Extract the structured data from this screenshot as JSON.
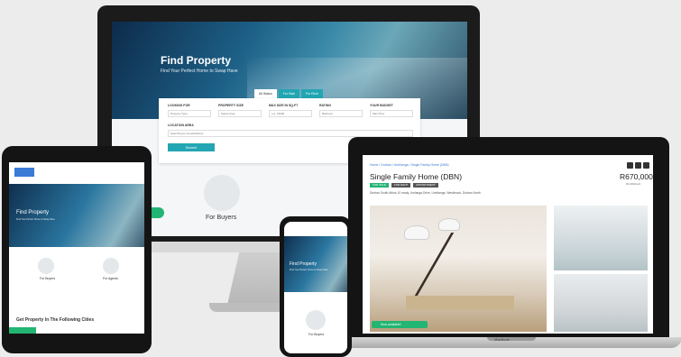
{
  "colors": {
    "accent": "#22a6b3",
    "success": "#22b573",
    "dark": "#141414"
  },
  "desktop": {
    "hero_title": "Find Property",
    "hero_subtitle": "Find Your Perfect Home to Swap Have",
    "tabs": [
      "All Status",
      "For Sale",
      "For Rent"
    ],
    "fields": [
      {
        "label": "LOOKING FOR",
        "value": "Property Type"
      },
      {
        "label": "PROPERTY SIZE",
        "value": "Select Area"
      },
      {
        "label": "MAX SIZE IN SQ.FT",
        "value": "e.g. 15000"
      },
      {
        "label": "RATING",
        "value": "Bedroom"
      },
      {
        "label": "YOUR BUDGET",
        "value": "Max Price"
      }
    ],
    "location_label": "LOCATION AREA",
    "location_value": "Searching by Area/Address",
    "search_button": "Search",
    "buyers_label": "For Buyers"
  },
  "tablet": {
    "hero_title": "Find Property",
    "hero_subtitle": "Find Your Perfect Home to Swap Have",
    "cards": [
      "For Buyers",
      "For Agents"
    ],
    "bottom_heading": "Get Property In The Following Cities"
  },
  "laptop": {
    "breadcrumb": "Home / Durban / Umhlanga / Single Family Home (DBN)",
    "title": "Single Family Home (DBN)",
    "price": "R670,000",
    "price_sub": "R1,000/sq.ft",
    "tags": [
      "FOR SALE",
      "FOR RENT",
      "APPOINTMENT"
    ],
    "address": "Durban South Africa 10 ready, Umlanga Drive, Umhlanga, Westbrook, Durban North",
    "status_button": "Now available!",
    "brand": "MacBook"
  },
  "phone": {
    "hero_title": "Find Property",
    "hero_subtitle": "Find Your Perfect Home to Swap Have",
    "card_caption": "For Buyers"
  }
}
